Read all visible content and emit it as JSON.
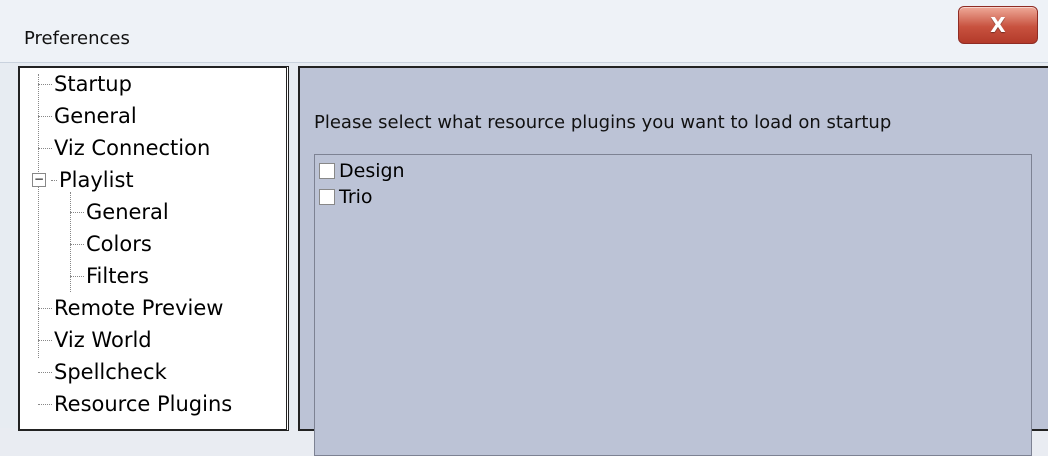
{
  "window": {
    "title": "Preferences",
    "close_label": "X"
  },
  "tree": {
    "items": [
      {
        "label": "Startup"
      },
      {
        "label": "General"
      },
      {
        "label": "Viz Connection"
      },
      {
        "label": "Playlist",
        "expanded": true,
        "children": [
          {
            "label": "General"
          },
          {
            "label": "Colors"
          },
          {
            "label": "Filters"
          }
        ]
      },
      {
        "label": "Remote Preview"
      },
      {
        "label": "Viz World"
      },
      {
        "label": "Spellcheck"
      },
      {
        "label": "Resource Plugins"
      }
    ],
    "expander_symbol": "−"
  },
  "panel": {
    "prompt": "Please select what resource plugins you want to load on startup",
    "plugins": [
      {
        "label": "Design",
        "checked": false
      },
      {
        "label": "Trio",
        "checked": false
      }
    ]
  }
}
